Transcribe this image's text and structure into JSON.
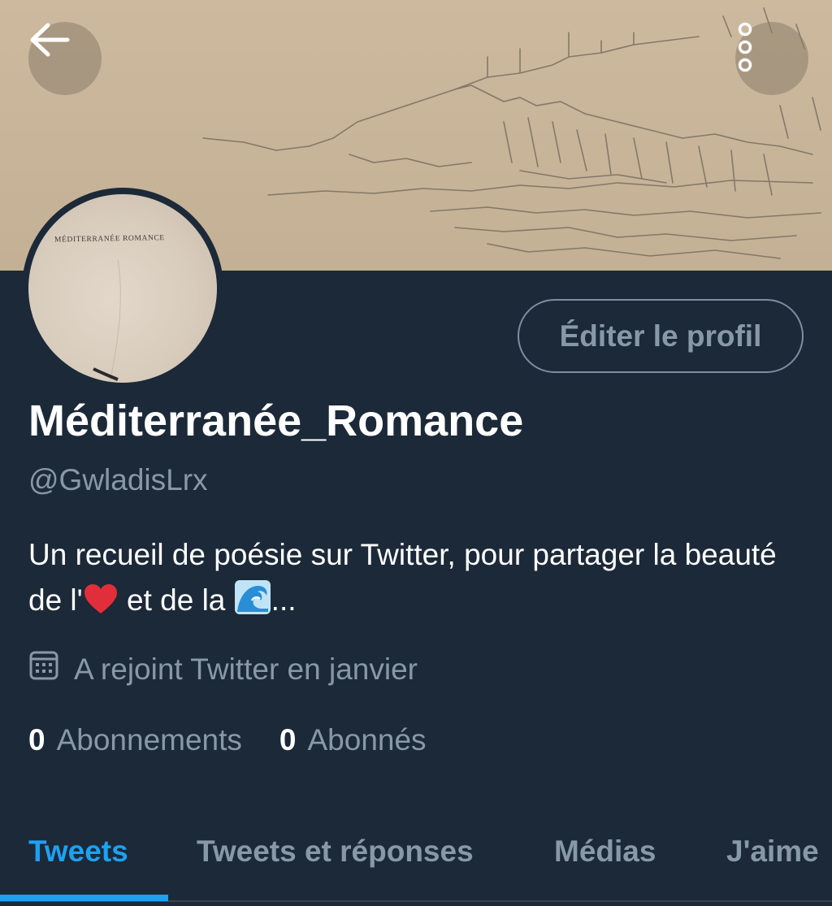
{
  "banner": {
    "back_icon": "arrow-left-icon",
    "more_icon": "more-vertical-icon"
  },
  "avatar": {
    "text": "MÉDITERRANÉE ROMANCE"
  },
  "profile": {
    "edit_button_label": "Éditer le profil",
    "display_name": "Méditerranée_Romance",
    "handle": "@GwladisLrx",
    "bio_part1": "Un recueil de poésie sur Twitter, pour partager la beauté de l'",
    "bio_part2": " et de la ",
    "bio_part3": "...",
    "bio_heart_icon": "red-heart-emoji",
    "bio_wave_icon": "water-wave-emoji",
    "joined_icon": "calendar-icon",
    "joined_text": "A rejoint Twitter en janvier"
  },
  "stats": {
    "following_count": "0",
    "following_label": "Abonnements",
    "followers_count": "0",
    "followers_label": "Abonnés"
  },
  "tabs": [
    {
      "label": "Tweets",
      "active": true
    },
    {
      "label": "Tweets et réponses",
      "active": false
    },
    {
      "label": "Médias",
      "active": false
    },
    {
      "label": "J'aime",
      "active": false
    }
  ],
  "colors": {
    "background": "#1c2938",
    "accent": "#1da1f2",
    "secondary_text": "#8899a6"
  }
}
